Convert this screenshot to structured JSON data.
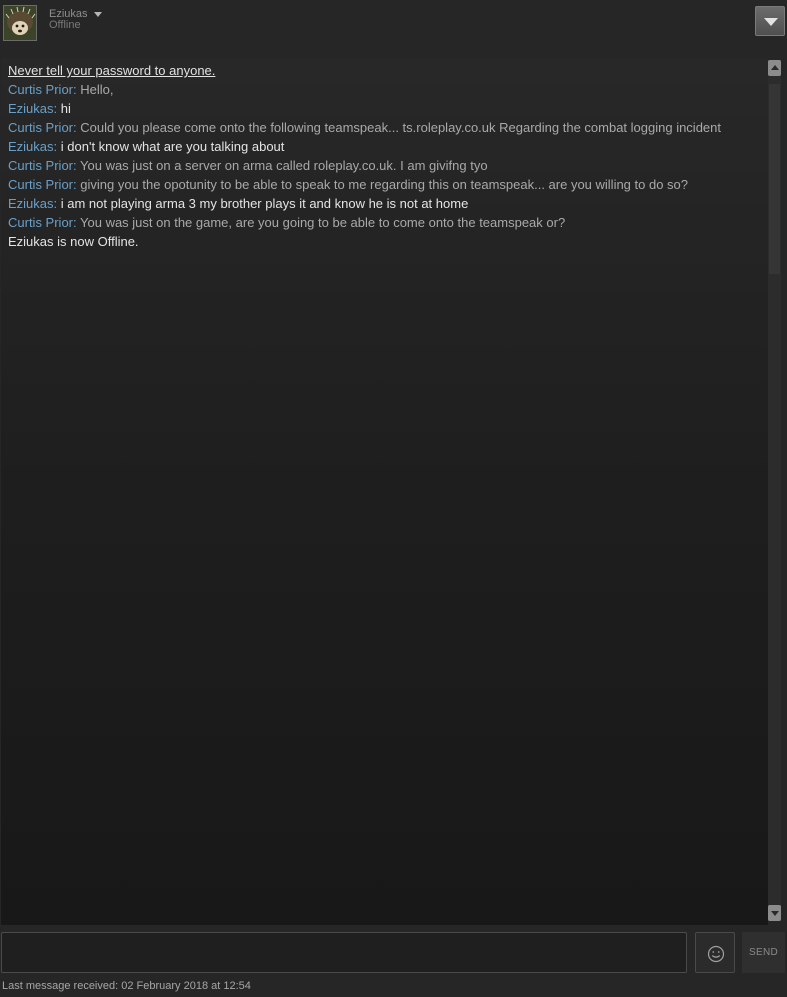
{
  "header": {
    "friend_name": "Eziukas",
    "friend_status": "Offline",
    "avatar_icon": "hedgehog-avatar",
    "menu_icon": "dropdown-arrow-icon"
  },
  "chat": {
    "security_warning": "Never tell your password to anyone.",
    "messages": [
      {
        "sender": "Curtis Prior",
        "text": "Hello,",
        "self": false
      },
      {
        "sender": "Eziukas",
        "text": "hi",
        "self": true
      },
      {
        "sender": "Curtis Prior",
        "text": "Could you please come onto the following teamspeak... ts.roleplay.co.uk Regarding the combat logging incident",
        "self": false
      },
      {
        "sender": "Eziukas",
        "text": "i don't know what are you talking about",
        "self": true
      },
      {
        "sender": "Curtis Prior",
        "text": "You was just on a server on arma called roleplay.co.uk. I am givifng tyo",
        "self": false
      },
      {
        "sender": "Curtis Prior",
        "text": "giving you the opotunity to be able to speak to me regarding this on teamspeak... are you willing to do so?",
        "self": false
      },
      {
        "sender": "Eziukas",
        "text": "i am not playing arma 3 my brother plays it and know he is not at home",
        "self": true
      },
      {
        "sender": "Curtis Prior",
        "text": "You was just on the game, are you going to be able to come onto the teamspeak or?",
        "self": false
      }
    ],
    "system_message": "Eziukas is now Offline.",
    "separator": ": "
  },
  "composer": {
    "input_value": "",
    "emoticon_icon": "smiley-icon",
    "send_label": "SEND"
  },
  "footer": {
    "last_message": "Last message received: 02 February 2018 at 12:54"
  },
  "colors": {
    "background": "#262626",
    "sender_name": "#6aa0c8",
    "other_message": "#a9a9a9",
    "self_message": "#e4e4e4"
  }
}
